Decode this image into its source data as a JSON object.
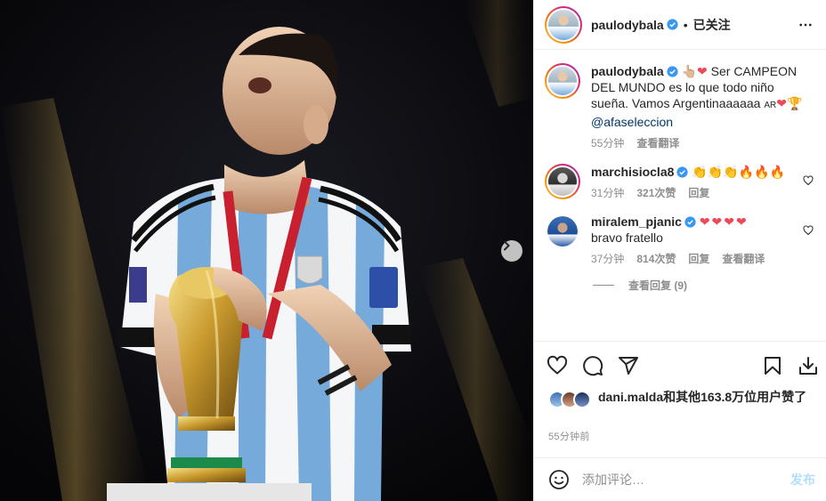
{
  "post": {
    "author": "paulodybala",
    "follow_state": "已关注",
    "caption_text": "Ser CAMPEON DEL MUNDO es lo que todo niño sueña. Vamos Argentinaaaaaa",
    "caption_flag": "AR",
    "caption_mention": "@afaseleccion",
    "caption_time": "55分钟",
    "caption_translate": "查看翻译"
  },
  "comments": [
    {
      "username": "marchisiocla8",
      "time": "31分钟",
      "likes": "321次赞",
      "reply": "回复",
      "emoji_text": "👏👏👏🔥🔥🔥"
    },
    {
      "username": "miralem_pjanic",
      "text": "bravo fratello",
      "time": "37分钟",
      "likes": "814次赞",
      "reply": "回复",
      "translate": "查看翻译",
      "view_replies": "查看回复 (9)"
    }
  ],
  "likes_summary": {
    "user": "dani.malda",
    "rest": "和其他163.8万位用户赞了"
  },
  "post_time": "55分钟前",
  "add_comment": {
    "placeholder": "添加评论…",
    "post_label": "发布"
  },
  "colors": {
    "accent_link": "#00376b",
    "heart_red": "#ed4956",
    "post_button": "#b2dffc",
    "verified_blue": "#3897f0"
  },
  "icons": [
    "heart-icon",
    "comment-icon",
    "share-icon",
    "bookmark-icon",
    "download-icon",
    "more-icon",
    "emoji-icon",
    "verified-badge-icon",
    "next-arrow-icon"
  ]
}
